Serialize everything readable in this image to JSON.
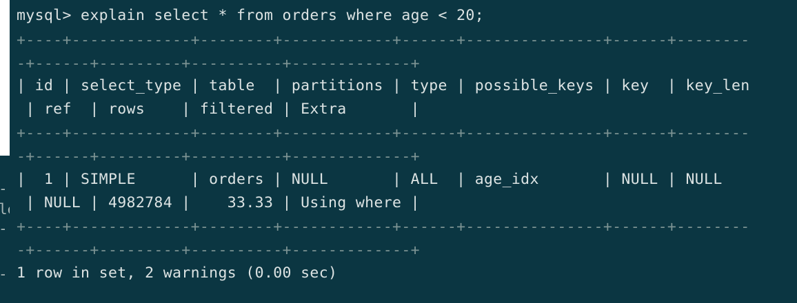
{
  "terminal": {
    "lines": [
      {
        "kind": "prompt",
        "text": "mysql> explain select * from orders where age < 20;"
      },
      {
        "kind": "border",
        "text": "+----+-------------+--------+------------+------+---------------+------+--------"
      },
      {
        "kind": "border",
        "text": "-+------+---------+----------+-------------+"
      },
      {
        "kind": "text",
        "text": "| id | select_type | table  | partitions | type | possible_keys | key  | key_len"
      },
      {
        "kind": "text",
        "text": " | ref  | rows    | filtered | Extra       |"
      },
      {
        "kind": "border",
        "text": "+----+-------------+--------+------------+------+---------------+------+--------"
      },
      {
        "kind": "border",
        "text": "-+------+---------+----------+-------------+"
      },
      {
        "kind": "text",
        "text": "|  1 | SIMPLE      | orders | NULL       | ALL  | age_idx       | NULL | NULL"
      },
      {
        "kind": "text",
        "text": " | NULL | 4982784 |    33.33 | Using where |"
      },
      {
        "kind": "border",
        "text": "+----+-------------+--------+------------+------+---------------+------+--------"
      },
      {
        "kind": "border",
        "text": "-+------+---------+----------+-------------+"
      },
      {
        "kind": "text",
        "text": "1 row in set, 2 warnings (0.00 sec)"
      }
    ]
  },
  "background_window": {
    "fragments": [
      "--",
      "le",
      "--",
      "--"
    ]
  },
  "colors": {
    "background": "#0b3642",
    "text": "#dce3e3",
    "border": "#7d9494"
  }
}
